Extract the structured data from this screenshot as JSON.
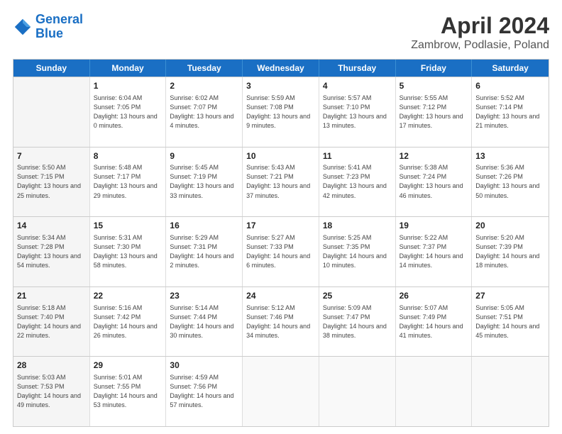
{
  "logo": {
    "line1": "General",
    "line2": "Blue"
  },
  "title": "April 2024",
  "subtitle": "Zambrow, Podlasie, Poland",
  "days": [
    "Sunday",
    "Monday",
    "Tuesday",
    "Wednesday",
    "Thursday",
    "Friday",
    "Saturday"
  ],
  "weeks": [
    [
      {
        "day": "",
        "sunrise": "",
        "sunset": "",
        "daylight": "",
        "shaded": true
      },
      {
        "day": "1",
        "sunrise": "Sunrise: 6:04 AM",
        "sunset": "Sunset: 7:05 PM",
        "daylight": "Daylight: 13 hours and 0 minutes."
      },
      {
        "day": "2",
        "sunrise": "Sunrise: 6:02 AM",
        "sunset": "Sunset: 7:07 PM",
        "daylight": "Daylight: 13 hours and 4 minutes."
      },
      {
        "day": "3",
        "sunrise": "Sunrise: 5:59 AM",
        "sunset": "Sunset: 7:08 PM",
        "daylight": "Daylight: 13 hours and 9 minutes."
      },
      {
        "day": "4",
        "sunrise": "Sunrise: 5:57 AM",
        "sunset": "Sunset: 7:10 PM",
        "daylight": "Daylight: 13 hours and 13 minutes."
      },
      {
        "day": "5",
        "sunrise": "Sunrise: 5:55 AM",
        "sunset": "Sunset: 7:12 PM",
        "daylight": "Daylight: 13 hours and 17 minutes."
      },
      {
        "day": "6",
        "sunrise": "Sunrise: 5:52 AM",
        "sunset": "Sunset: 7:14 PM",
        "daylight": "Daylight: 13 hours and 21 minutes."
      }
    ],
    [
      {
        "day": "7",
        "sunrise": "Sunrise: 5:50 AM",
        "sunset": "Sunset: 7:15 PM",
        "daylight": "Daylight: 13 hours and 25 minutes.",
        "shaded": true
      },
      {
        "day": "8",
        "sunrise": "Sunrise: 5:48 AM",
        "sunset": "Sunset: 7:17 PM",
        "daylight": "Daylight: 13 hours and 29 minutes."
      },
      {
        "day": "9",
        "sunrise": "Sunrise: 5:45 AM",
        "sunset": "Sunset: 7:19 PM",
        "daylight": "Daylight: 13 hours and 33 minutes."
      },
      {
        "day": "10",
        "sunrise": "Sunrise: 5:43 AM",
        "sunset": "Sunset: 7:21 PM",
        "daylight": "Daylight: 13 hours and 37 minutes."
      },
      {
        "day": "11",
        "sunrise": "Sunrise: 5:41 AM",
        "sunset": "Sunset: 7:23 PM",
        "daylight": "Daylight: 13 hours and 42 minutes."
      },
      {
        "day": "12",
        "sunrise": "Sunrise: 5:38 AM",
        "sunset": "Sunset: 7:24 PM",
        "daylight": "Daylight: 13 hours and 46 minutes."
      },
      {
        "day": "13",
        "sunrise": "Sunrise: 5:36 AM",
        "sunset": "Sunset: 7:26 PM",
        "daylight": "Daylight: 13 hours and 50 minutes."
      }
    ],
    [
      {
        "day": "14",
        "sunrise": "Sunrise: 5:34 AM",
        "sunset": "Sunset: 7:28 PM",
        "daylight": "Daylight: 13 hours and 54 minutes.",
        "shaded": true
      },
      {
        "day": "15",
        "sunrise": "Sunrise: 5:31 AM",
        "sunset": "Sunset: 7:30 PM",
        "daylight": "Daylight: 13 hours and 58 minutes."
      },
      {
        "day": "16",
        "sunrise": "Sunrise: 5:29 AM",
        "sunset": "Sunset: 7:31 PM",
        "daylight": "Daylight: 14 hours and 2 minutes."
      },
      {
        "day": "17",
        "sunrise": "Sunrise: 5:27 AM",
        "sunset": "Sunset: 7:33 PM",
        "daylight": "Daylight: 14 hours and 6 minutes."
      },
      {
        "day": "18",
        "sunrise": "Sunrise: 5:25 AM",
        "sunset": "Sunset: 7:35 PM",
        "daylight": "Daylight: 14 hours and 10 minutes."
      },
      {
        "day": "19",
        "sunrise": "Sunrise: 5:22 AM",
        "sunset": "Sunset: 7:37 PM",
        "daylight": "Daylight: 14 hours and 14 minutes."
      },
      {
        "day": "20",
        "sunrise": "Sunrise: 5:20 AM",
        "sunset": "Sunset: 7:39 PM",
        "daylight": "Daylight: 14 hours and 18 minutes."
      }
    ],
    [
      {
        "day": "21",
        "sunrise": "Sunrise: 5:18 AM",
        "sunset": "Sunset: 7:40 PM",
        "daylight": "Daylight: 14 hours and 22 minutes.",
        "shaded": true
      },
      {
        "day": "22",
        "sunrise": "Sunrise: 5:16 AM",
        "sunset": "Sunset: 7:42 PM",
        "daylight": "Daylight: 14 hours and 26 minutes."
      },
      {
        "day": "23",
        "sunrise": "Sunrise: 5:14 AM",
        "sunset": "Sunset: 7:44 PM",
        "daylight": "Daylight: 14 hours and 30 minutes."
      },
      {
        "day": "24",
        "sunrise": "Sunrise: 5:12 AM",
        "sunset": "Sunset: 7:46 PM",
        "daylight": "Daylight: 14 hours and 34 minutes."
      },
      {
        "day": "25",
        "sunrise": "Sunrise: 5:09 AM",
        "sunset": "Sunset: 7:47 PM",
        "daylight": "Daylight: 14 hours and 38 minutes."
      },
      {
        "day": "26",
        "sunrise": "Sunrise: 5:07 AM",
        "sunset": "Sunset: 7:49 PM",
        "daylight": "Daylight: 14 hours and 41 minutes."
      },
      {
        "day": "27",
        "sunrise": "Sunrise: 5:05 AM",
        "sunset": "Sunset: 7:51 PM",
        "daylight": "Daylight: 14 hours and 45 minutes."
      }
    ],
    [
      {
        "day": "28",
        "sunrise": "Sunrise: 5:03 AM",
        "sunset": "Sunset: 7:53 PM",
        "daylight": "Daylight: 14 hours and 49 minutes.",
        "shaded": true
      },
      {
        "day": "29",
        "sunrise": "Sunrise: 5:01 AM",
        "sunset": "Sunset: 7:55 PM",
        "daylight": "Daylight: 14 hours and 53 minutes."
      },
      {
        "day": "30",
        "sunrise": "Sunrise: 4:59 AM",
        "sunset": "Sunset: 7:56 PM",
        "daylight": "Daylight: 14 hours and 57 minutes."
      },
      {
        "day": "",
        "sunrise": "",
        "sunset": "",
        "daylight": "",
        "empty": true
      },
      {
        "day": "",
        "sunrise": "",
        "sunset": "",
        "daylight": "",
        "empty": true
      },
      {
        "day": "",
        "sunrise": "",
        "sunset": "",
        "daylight": "",
        "empty": true
      },
      {
        "day": "",
        "sunrise": "",
        "sunset": "",
        "daylight": "",
        "empty": true
      }
    ]
  ]
}
